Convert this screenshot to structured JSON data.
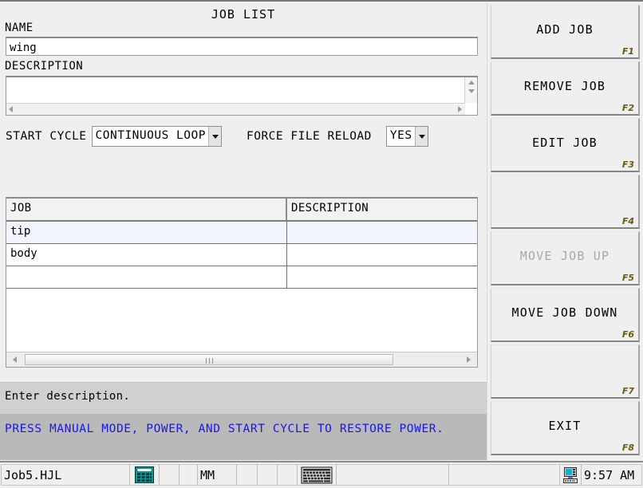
{
  "window": {
    "title": "JOB LIST"
  },
  "form": {
    "name_label": "NAME",
    "name_value": "wing",
    "description_label": "DESCRIPTION",
    "description_value": "",
    "start_cycle_label": "START CYCLE",
    "start_cycle_value": "CONTINUOUS LOOP",
    "force_file_reload_label": "FORCE FILE RELOAD",
    "force_file_reload_value": "YES"
  },
  "table": {
    "columns": [
      "JOB",
      "DESCRIPTION"
    ],
    "rows": [
      {
        "job": "tip",
        "description": "",
        "selected": true
      },
      {
        "job": "body",
        "description": "",
        "selected": false
      },
      {
        "job": "",
        "description": "",
        "selected": false
      }
    ]
  },
  "messages": {
    "prompt": "Enter description.",
    "alert": "PRESS MANUAL MODE, POWER, AND START CYCLE TO RESTORE POWER.",
    "alert_color": "#1818e6"
  },
  "function_keys": [
    {
      "label": "ADD JOB",
      "key": "F1",
      "disabled": false
    },
    {
      "label": "REMOVE JOB",
      "key": "F2",
      "disabled": false
    },
    {
      "label": "EDIT JOB",
      "key": "F3",
      "disabled": false
    },
    {
      "label": "",
      "key": "F4",
      "disabled": false
    },
    {
      "label": "MOVE JOB UP",
      "key": "F5",
      "disabled": true
    },
    {
      "label": "MOVE JOB DOWN",
      "key": "F6",
      "disabled": false
    },
    {
      "label": "",
      "key": "F7",
      "disabled": false
    },
    {
      "label": "EXIT",
      "key": "F8",
      "disabled": false
    }
  ],
  "statusbar": {
    "file_name": "Job5.HJL",
    "calculator_icon": "calculator-icon",
    "units": "MM",
    "keyboard_icon": "keyboard-icon",
    "computer_icon": "computer-icon",
    "time": "9:57 AM"
  },
  "colors": {
    "panel_bg": "#efefef",
    "message_bg": "#d0d0d0",
    "alert_bg": "#b9b9b9",
    "selected_row": "#f2f5fb",
    "fkey_label": "#6b5a10",
    "disabled_text": "#a8a8a8"
  }
}
